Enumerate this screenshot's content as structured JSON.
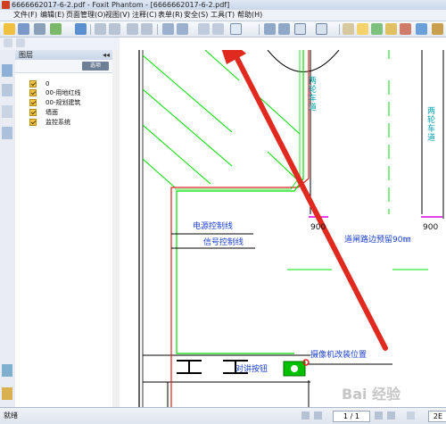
{
  "window": {
    "title": "6666662017-6-2.pdf - Foxit Phantom - [6666662017-6-2.pdf]"
  },
  "menu": [
    "文件(F)",
    "编辑(E)",
    "页面管理(O)",
    "视图(V)",
    "注释(C)",
    "表单(R)",
    "安全(S)",
    "工具(T)",
    "帮助(H)"
  ],
  "panel": {
    "title": "图层",
    "collapse": "◂◂",
    "option_button": "选项",
    "layers": [
      "0",
      "00-用地红线",
      "00-规划建筑",
      "墙面",
      "监控系统"
    ]
  },
  "drawing": {
    "label_lane_1": "两轮车道",
    "label_lane_2": "两轮车道",
    "label_power": "电源控制线",
    "label_signal": "信号控制线",
    "dim_1": "900",
    "dim_2": "900",
    "label_reserve": "道闸路边预留90㎜",
    "label_camera": "摄像机改装位置",
    "label_button": "对讲按钮"
  },
  "status": {
    "text": "就绪",
    "page": "1 / 1",
    "zoom": "2E"
  },
  "watermark": "Bai 经验",
  "colors": {
    "cad_green": "#00e000",
    "cad_red": "#e02020",
    "cad_cyan": "#00a0b0",
    "arrow_red": "#e02a20",
    "magenta": "#e000e0"
  }
}
